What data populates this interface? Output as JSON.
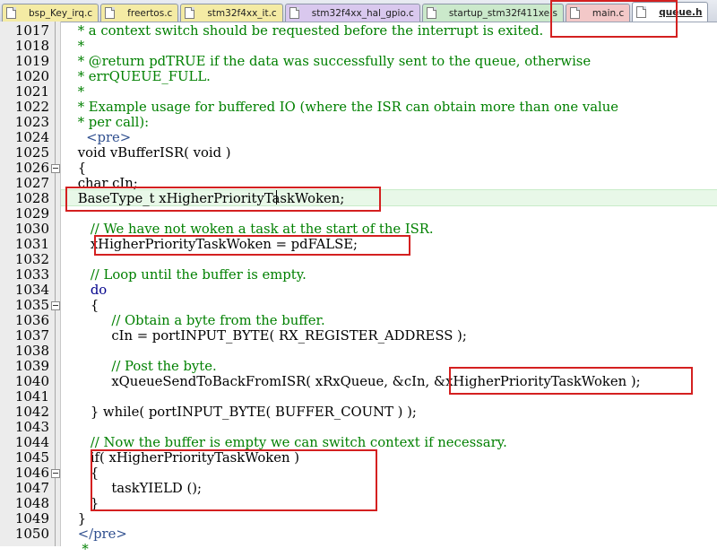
{
  "tabs": [
    {
      "label": "bsp_Key_irq.c",
      "color": "yellow",
      "active": false
    },
    {
      "label": "freertos.c",
      "color": "yellow",
      "active": false
    },
    {
      "label": "stm32f4xx_it.c",
      "color": "yellow",
      "active": false
    },
    {
      "label": "stm32f4xx_hal_gpio.c",
      "color": "purple",
      "active": false
    },
    {
      "label": "startup_stm32f411xe.s",
      "color": "green",
      "active": false
    },
    {
      "label": "main.c",
      "color": "pink",
      "active": false
    },
    {
      "label": "queue.h",
      "color": "white",
      "active": true
    }
  ],
  "lines": [
    {
      "n": "1017",
      "t": " * a context switch should be requested before the interrupt is exited.",
      "k": "cmt"
    },
    {
      "n": "1018",
      "t": " *",
      "k": "cmt"
    },
    {
      "n": "1019",
      "t": " * @return pdTRUE if the data was successfully sent to the queue, otherwise",
      "k": "cmt"
    },
    {
      "n": "1020",
      "t": " * errQUEUE_FULL.",
      "k": "cmt"
    },
    {
      "n": "1021",
      "t": " *",
      "k": "cmt"
    },
    {
      "n": "1022",
      "t": " * Example usage for buffered IO (where the ISR can obtain more than one value",
      "k": "cmt"
    },
    {
      "n": "1023",
      "t": " * per call):",
      "k": "cmt"
    },
    {
      "n": "1024",
      "t": "   <pre>",
      "k": "tag"
    },
    {
      "n": "1025",
      "t": " void vBufferISR( void )",
      "k": "plain"
    },
    {
      "n": "1026",
      "t": " {",
      "k": "plain"
    },
    {
      "n": "1027",
      "t": " char cIn;",
      "k": "plain"
    },
    {
      "n": "1028",
      "t": " BaseType_t xHigherPriorityTaskWoken;",
      "k": "plain"
    },
    {
      "n": "1029",
      "t": "",
      "k": "plain"
    },
    {
      "n": "1030",
      "t": "    // We have not woken a task at the start of the ISR.",
      "k": "cmt"
    },
    {
      "n": "1031",
      "t": "    xHigherPriorityTaskWoken = pdFALSE;",
      "k": "plain"
    },
    {
      "n": "1032",
      "t": "",
      "k": "plain"
    },
    {
      "n": "1033",
      "t": "    // Loop until the buffer is empty.",
      "k": "cmt"
    },
    {
      "n": "1034",
      "t": "    do",
      "k": "kw"
    },
    {
      "n": "1035",
      "t": "    {",
      "k": "plain"
    },
    {
      "n": "1036",
      "t": "         // Obtain a byte from the buffer.",
      "k": "cmt"
    },
    {
      "n": "1037",
      "t": "         cIn = portINPUT_BYTE( RX_REGISTER_ADDRESS );",
      "k": "plain"
    },
    {
      "n": "1038",
      "t": "",
      "k": "plain"
    },
    {
      "n": "1039",
      "t": "         // Post the byte.",
      "k": "cmt"
    },
    {
      "n": "1040",
      "t": "         xQueueSendToBackFromISR( xRxQueue, &cIn, &xHigherPriorityTaskWoken );",
      "k": "plain"
    },
    {
      "n": "1041",
      "t": "",
      "k": "plain"
    },
    {
      "n": "1042",
      "t": "    } while( portINPUT_BYTE( BUFFER_COUNT ) );",
      "k": "plain"
    },
    {
      "n": "1043",
      "t": "",
      "k": "plain"
    },
    {
      "n": "1044",
      "t": "    // Now the buffer is empty we can switch context if necessary.",
      "k": "cmt"
    },
    {
      "n": "1045",
      "t": "    if( xHigherPriorityTaskWoken )",
      "k": "plain"
    },
    {
      "n": "1046",
      "t": "    {",
      "k": "plain"
    },
    {
      "n": "1047",
      "t": "         taskYIELD ();",
      "k": "plain"
    },
    {
      "n": "1048",
      "t": "    }",
      "k": "plain"
    },
    {
      "n": "1049",
      "t": " }",
      "k": "plain"
    },
    {
      "n": "1050",
      "t": " </pre>",
      "k": "tag"
    },
    {
      "n": "",
      "t": "  *",
      "k": "cmt"
    }
  ],
  "colors": {
    "comment": "#008000",
    "keyword": "#00008b",
    "tag": "#2f4f8f",
    "highlight_box": "#d42020",
    "current_line": "#e8f8e8"
  }
}
